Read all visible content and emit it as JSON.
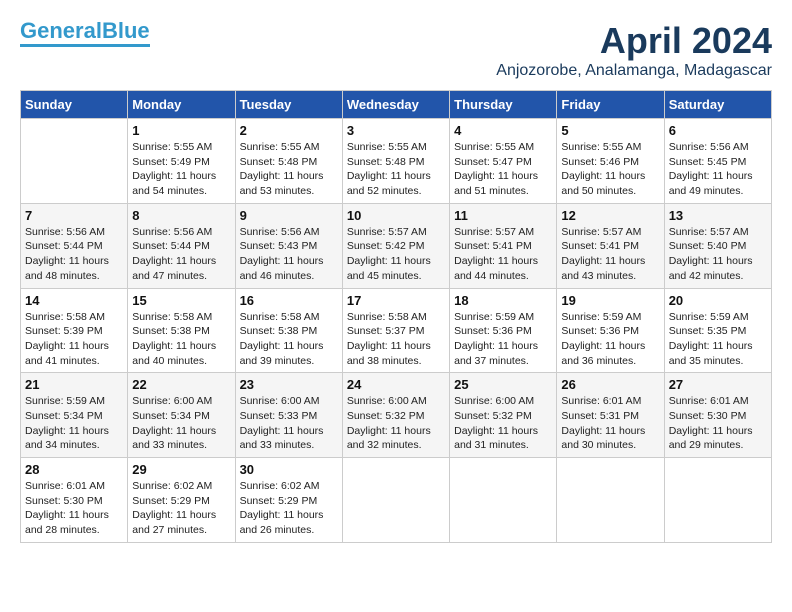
{
  "logo": {
    "part1": "General",
    "part2": "Blue"
  },
  "title": "April 2024",
  "location": "Anjozorobe, Analamanga, Madagascar",
  "headers": [
    "Sunday",
    "Monday",
    "Tuesday",
    "Wednesday",
    "Thursday",
    "Friday",
    "Saturday"
  ],
  "weeks": [
    [
      {
        "day": "",
        "info": ""
      },
      {
        "day": "1",
        "info": "Sunrise: 5:55 AM\nSunset: 5:49 PM\nDaylight: 11 hours\nand 54 minutes."
      },
      {
        "day": "2",
        "info": "Sunrise: 5:55 AM\nSunset: 5:48 PM\nDaylight: 11 hours\nand 53 minutes."
      },
      {
        "day": "3",
        "info": "Sunrise: 5:55 AM\nSunset: 5:48 PM\nDaylight: 11 hours\nand 52 minutes."
      },
      {
        "day": "4",
        "info": "Sunrise: 5:55 AM\nSunset: 5:47 PM\nDaylight: 11 hours\nand 51 minutes."
      },
      {
        "day": "5",
        "info": "Sunrise: 5:55 AM\nSunset: 5:46 PM\nDaylight: 11 hours\nand 50 minutes."
      },
      {
        "day": "6",
        "info": "Sunrise: 5:56 AM\nSunset: 5:45 PM\nDaylight: 11 hours\nand 49 minutes."
      }
    ],
    [
      {
        "day": "7",
        "info": "Sunrise: 5:56 AM\nSunset: 5:44 PM\nDaylight: 11 hours\nand 48 minutes."
      },
      {
        "day": "8",
        "info": "Sunrise: 5:56 AM\nSunset: 5:44 PM\nDaylight: 11 hours\nand 47 minutes."
      },
      {
        "day": "9",
        "info": "Sunrise: 5:56 AM\nSunset: 5:43 PM\nDaylight: 11 hours\nand 46 minutes."
      },
      {
        "day": "10",
        "info": "Sunrise: 5:57 AM\nSunset: 5:42 PM\nDaylight: 11 hours\nand 45 minutes."
      },
      {
        "day": "11",
        "info": "Sunrise: 5:57 AM\nSunset: 5:41 PM\nDaylight: 11 hours\nand 44 minutes."
      },
      {
        "day": "12",
        "info": "Sunrise: 5:57 AM\nSunset: 5:41 PM\nDaylight: 11 hours\nand 43 minutes."
      },
      {
        "day": "13",
        "info": "Sunrise: 5:57 AM\nSunset: 5:40 PM\nDaylight: 11 hours\nand 42 minutes."
      }
    ],
    [
      {
        "day": "14",
        "info": "Sunrise: 5:58 AM\nSunset: 5:39 PM\nDaylight: 11 hours\nand 41 minutes."
      },
      {
        "day": "15",
        "info": "Sunrise: 5:58 AM\nSunset: 5:38 PM\nDaylight: 11 hours\nand 40 minutes."
      },
      {
        "day": "16",
        "info": "Sunrise: 5:58 AM\nSunset: 5:38 PM\nDaylight: 11 hours\nand 39 minutes."
      },
      {
        "day": "17",
        "info": "Sunrise: 5:58 AM\nSunset: 5:37 PM\nDaylight: 11 hours\nand 38 minutes."
      },
      {
        "day": "18",
        "info": "Sunrise: 5:59 AM\nSunset: 5:36 PM\nDaylight: 11 hours\nand 37 minutes."
      },
      {
        "day": "19",
        "info": "Sunrise: 5:59 AM\nSunset: 5:36 PM\nDaylight: 11 hours\nand 36 minutes."
      },
      {
        "day": "20",
        "info": "Sunrise: 5:59 AM\nSunset: 5:35 PM\nDaylight: 11 hours\nand 35 minutes."
      }
    ],
    [
      {
        "day": "21",
        "info": "Sunrise: 5:59 AM\nSunset: 5:34 PM\nDaylight: 11 hours\nand 34 minutes."
      },
      {
        "day": "22",
        "info": "Sunrise: 6:00 AM\nSunset: 5:34 PM\nDaylight: 11 hours\nand 33 minutes."
      },
      {
        "day": "23",
        "info": "Sunrise: 6:00 AM\nSunset: 5:33 PM\nDaylight: 11 hours\nand 33 minutes."
      },
      {
        "day": "24",
        "info": "Sunrise: 6:00 AM\nSunset: 5:32 PM\nDaylight: 11 hours\nand 32 minutes."
      },
      {
        "day": "25",
        "info": "Sunrise: 6:00 AM\nSunset: 5:32 PM\nDaylight: 11 hours\nand 31 minutes."
      },
      {
        "day": "26",
        "info": "Sunrise: 6:01 AM\nSunset: 5:31 PM\nDaylight: 11 hours\nand 30 minutes."
      },
      {
        "day": "27",
        "info": "Sunrise: 6:01 AM\nSunset: 5:30 PM\nDaylight: 11 hours\nand 29 minutes."
      }
    ],
    [
      {
        "day": "28",
        "info": "Sunrise: 6:01 AM\nSunset: 5:30 PM\nDaylight: 11 hours\nand 28 minutes."
      },
      {
        "day": "29",
        "info": "Sunrise: 6:02 AM\nSunset: 5:29 PM\nDaylight: 11 hours\nand 27 minutes."
      },
      {
        "day": "30",
        "info": "Sunrise: 6:02 AM\nSunset: 5:29 PM\nDaylight: 11 hours\nand 26 minutes."
      },
      {
        "day": "",
        "info": ""
      },
      {
        "day": "",
        "info": ""
      },
      {
        "day": "",
        "info": ""
      },
      {
        "day": "",
        "info": ""
      }
    ]
  ]
}
